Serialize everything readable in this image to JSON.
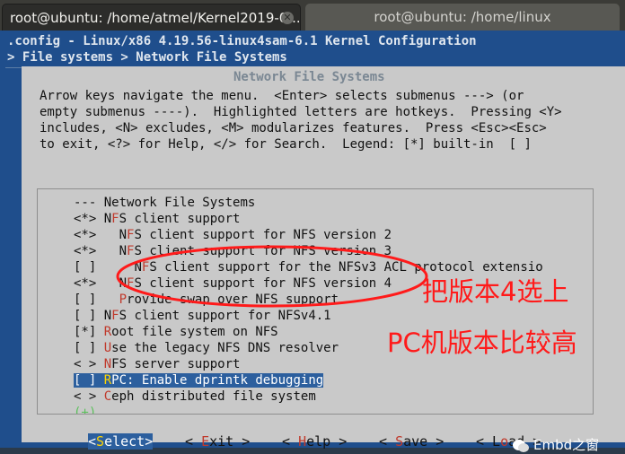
{
  "tabs": [
    {
      "title": "root@ubuntu: /home/atmel/Kernel2019-0...",
      "close_icon": "close-icon"
    },
    {
      "title": "root@ubuntu: /home/linux"
    }
  ],
  "header": {
    "title": ".config - Linux/x86 4.19.56-linux4sam-6.1 Kernel Configuration",
    "breadcrumb": "> File systems > Network File Systems"
  },
  "dialog": {
    "title": "Network File Systems",
    "help": [
      "Arrow keys navigate the menu.  <Enter> selects submenus ---> (or",
      "empty submenus ----).  Highlighted letters are hotkeys.  Pressing <Y>",
      "includes, <N> excludes, <M> modularizes features.  Press <Esc><Esc>",
      "to exit, <?> for Help, </> for Search.  Legend: [*] built-in  [ ]"
    ],
    "menu": [
      {
        "mark": "---",
        "pre": "",
        "hot": "",
        "rest": "Network File Systems",
        "indent": ""
      },
      {
        "mark": "<*>",
        "pre": "N",
        "hot": "F",
        "rest": "S client support",
        "indent": ""
      },
      {
        "mark": "<*>",
        "pre": "N",
        "hot": "F",
        "rest": "S client support for NFS version 2",
        "indent": "  "
      },
      {
        "mark": "<*>",
        "pre": "N",
        "hot": "F",
        "rest": "S client support for NFS version 3",
        "indent": "  "
      },
      {
        "mark": "[ ]",
        "pre": "N",
        "hot": "F",
        "rest": "S client support for the NFSv3 ACL protocol extensio",
        "indent": "    "
      },
      {
        "mark": "<*>",
        "pre": "N",
        "hot": "F",
        "rest": "S client support for NFS version 4",
        "indent": "  "
      },
      {
        "mark": "[ ]",
        "pre": "",
        "hot": "P",
        "rest": "rovide swap over NFS support",
        "indent": "  "
      },
      {
        "mark": "[ ]",
        "pre": "N",
        "hot": "F",
        "rest": "S client support for NFSv4.1",
        "indent": ""
      },
      {
        "mark": "[*]",
        "pre": "",
        "hot": "R",
        "rest": "oot file system on NFS",
        "indent": ""
      },
      {
        "mark": "[ ]",
        "pre": "",
        "hot": "U",
        "rest": "se the legacy NFS DNS resolver",
        "indent": ""
      },
      {
        "mark": "< >",
        "pre": "",
        "hot": "N",
        "rest": "FS server support",
        "indent": ""
      },
      {
        "mark": "[ ]",
        "pre": "",
        "hot": "R",
        "rest": "PC: Enable dprintk debugging",
        "indent": "",
        "selected": true
      },
      {
        "mark": "< >",
        "pre": "",
        "hot": "C",
        "rest": "eph distributed file system",
        "indent": ""
      }
    ],
    "more": "(+)",
    "buttons": [
      {
        "pre": "<",
        "hot": "S",
        "rest": "elect>",
        "selected": true
      },
      {
        "pre": "< ",
        "hot": "E",
        "rest": "xit >"
      },
      {
        "pre": "< ",
        "hot": "H",
        "rest": "elp >"
      },
      {
        "pre": "< ",
        "hot": "S",
        "rest": "ave >"
      },
      {
        "pre": "< L",
        "hot": "o",
        "rest": "ad >"
      }
    ]
  },
  "annotations": {
    "line1": "把版本4选上",
    "line2": "PC机版本比较高",
    "color": "#ff1a1a"
  },
  "watermark": "Embd之窗",
  "colors": {
    "terminal_bg": "#1f4e8c",
    "dialog_bg": "#c9c9c9",
    "selection": "#2c5f9e",
    "hotkey": "#c0392b"
  }
}
